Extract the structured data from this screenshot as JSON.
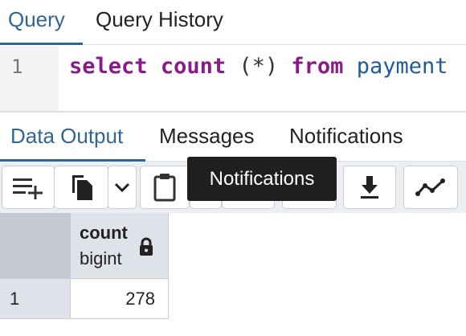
{
  "query_tabs": [
    {
      "label": "Query",
      "active": true
    },
    {
      "label": "Query History",
      "active": false
    }
  ],
  "editor": {
    "line_number": "1",
    "tokens": {
      "select": "select",
      "count": "count",
      "star": "(*)",
      "from": "from",
      "table": "payment"
    }
  },
  "output_tabs": [
    {
      "label": "Data Output",
      "active": true
    },
    {
      "label": "Messages",
      "active": false
    },
    {
      "label": "Notifications",
      "active": false
    }
  ],
  "toolbar": {
    "icons": [
      "add-row-icon",
      "copy-icon",
      "chevron-down-icon",
      "paste-icon",
      "download-icon",
      "graph-icon"
    ]
  },
  "tooltip": {
    "text": "Notifications"
  },
  "result_grid": {
    "columns": [
      {
        "name": "count",
        "type": "bigint",
        "locked": true
      }
    ],
    "rows": [
      {
        "row_number": "1",
        "values": [
          "278"
        ]
      }
    ]
  },
  "colors": {
    "accent": "#326690",
    "keyword": "#8a1c8a",
    "identifier": "#1f5c99",
    "tooltip_bg": "#1f1f1f"
  }
}
